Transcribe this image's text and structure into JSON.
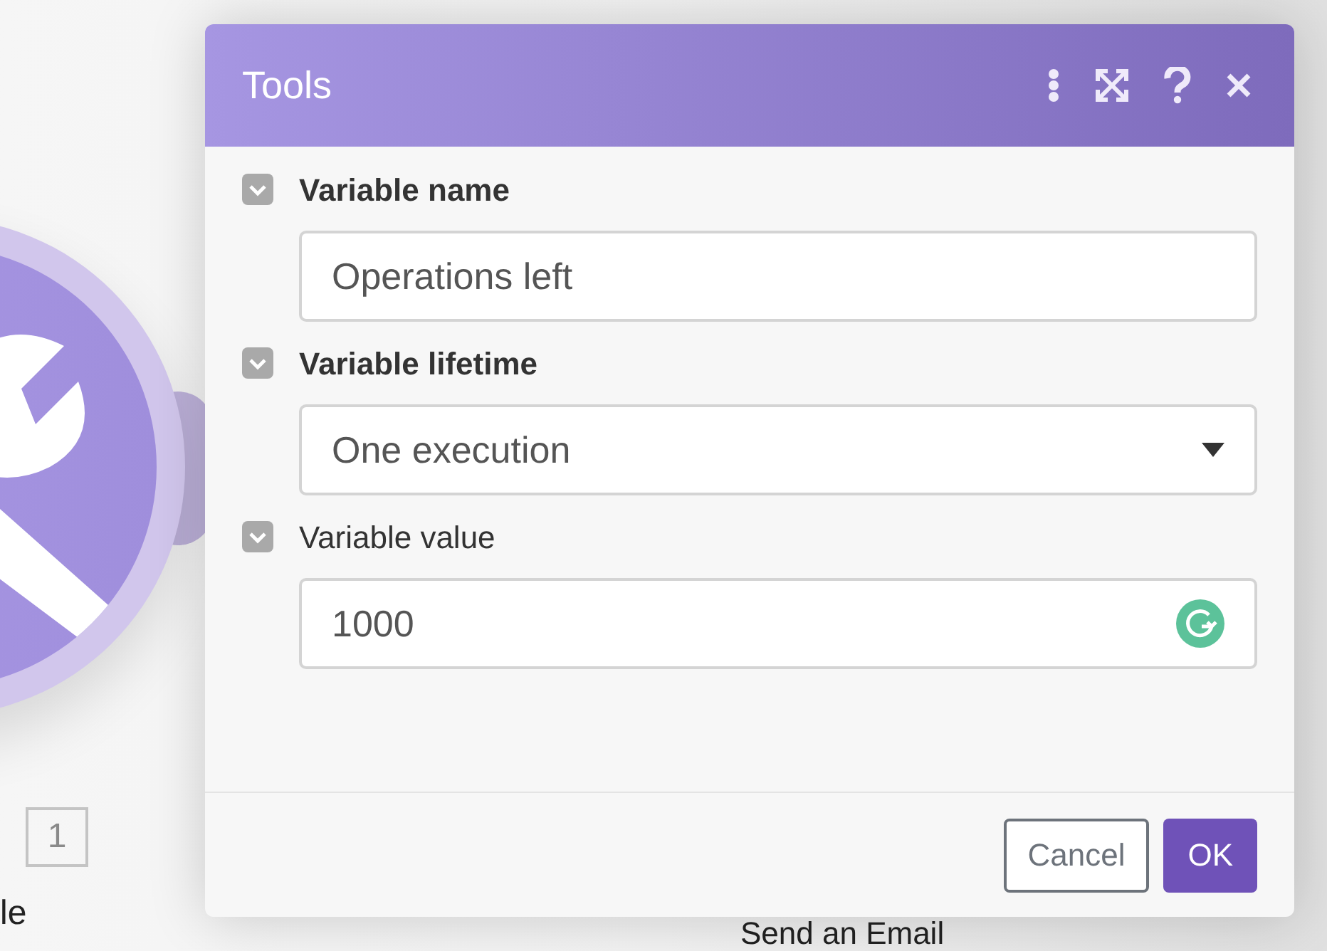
{
  "canvas": {
    "module_badge": "1",
    "module_label": "le",
    "next_module_label": "Send an Email"
  },
  "dialog": {
    "title": "Tools",
    "fields": [
      {
        "label": "Variable name",
        "required": true,
        "kind": "text",
        "value": "Operations left"
      },
      {
        "label": "Variable lifetime",
        "required": true,
        "kind": "select",
        "value": "One execution"
      },
      {
        "label": "Variable value",
        "required": false,
        "kind": "text",
        "value": "1000",
        "grammar_check": true
      }
    ],
    "buttons": [
      {
        "label": "Cancel",
        "kind": "secondary"
      },
      {
        "label": "OK",
        "kind": "primary"
      }
    ]
  }
}
